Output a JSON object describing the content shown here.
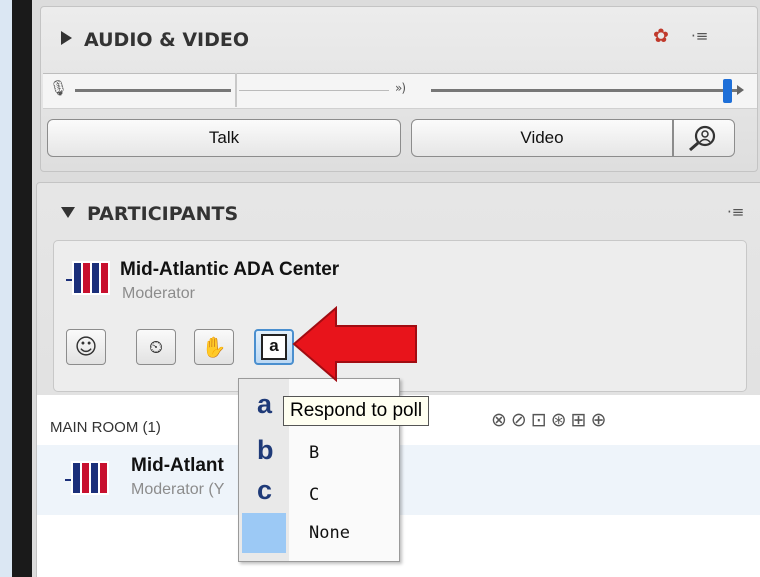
{
  "audio_video": {
    "header": "AUDIO & VIDEO",
    "talk_label": "Talk",
    "video_label": "Video",
    "settings_icon": "gear-heart-icon",
    "menu_icon": "panel-menu-icon",
    "mic_icon": "microphone-icon",
    "speaker_icon": "speaker-icon",
    "find_icon": "magnifier-person-icon"
  },
  "participants": {
    "header": "PARTICIPANTS",
    "current_user": {
      "name": "Mid-Atlantic ADA Center",
      "role": "Moderator"
    },
    "tools": [
      "emoticon-icon",
      "status-away-icon",
      "raise-hand-icon",
      "poll-response-icon"
    ],
    "room": {
      "label": "MAIN ROOM (1)",
      "member": {
        "name": "Mid-Atlant",
        "role": "Moderator (Y"
      }
    }
  },
  "poll_menu": {
    "tooltip": "Respond to poll",
    "options": [
      {
        "letter": "a",
        "label": ""
      },
      {
        "letter": "b",
        "label": "B"
      },
      {
        "letter": "c",
        "label": "C"
      },
      {
        "letter": "",
        "label": "None"
      }
    ]
  },
  "colors": {
    "accent_blue": "#1e6fd8",
    "arrow_red": "#e8141b",
    "none_swatch": "#9cc9f5",
    "page_bg": "#dbe7f3"
  }
}
